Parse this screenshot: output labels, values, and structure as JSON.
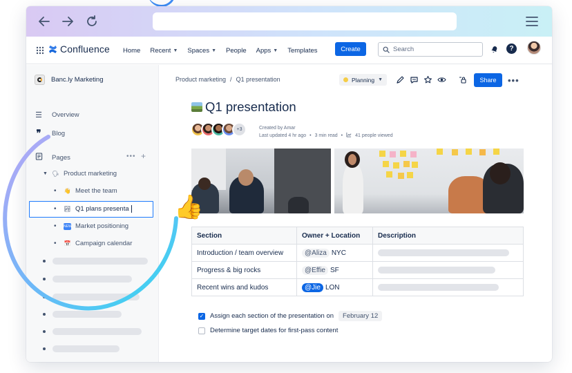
{
  "browser": {
    "back_icon": "arrow-left-icon",
    "forward_icon": "arrow-right-icon",
    "reload_icon": "reload-icon",
    "menu_icon": "hamburger-menu-icon"
  },
  "topnav": {
    "logo_text": "Confluence",
    "items": [
      "Home",
      "Recent",
      "Spaces",
      "People",
      "Apps",
      "Templates"
    ],
    "create_label": "Create",
    "search_placeholder": "Search"
  },
  "sidebar": {
    "space_name": "Banc.ly Marketing",
    "overview_label": "Overview",
    "blog_label": "Blog",
    "pages_label": "Pages",
    "tree": {
      "parent": "Product marketing",
      "children": [
        {
          "label": "Meet the team",
          "emoji": "👋"
        },
        {
          "label": "Q1 plans presenta",
          "emoji": "🏞"
        },
        {
          "label": "Market positioning",
          "emoji": "🆕"
        },
        {
          "label": "Campaign calendar",
          "emoji": "📅"
        }
      ]
    }
  },
  "page": {
    "breadcrumb": [
      "Product marketing",
      "/",
      "Q1 presentation"
    ],
    "status_label": "Planning",
    "share_label": "Share",
    "title": "Q1 presentation",
    "extra_contributors": "+3",
    "created_by": "Created by Amar",
    "last_updated": "Last updated 4 hr ago",
    "read_time": "3 min read",
    "people_viewed": "41 people viewed"
  },
  "table": {
    "headers": [
      "Section",
      "Owner + Location",
      "Description"
    ],
    "rows": [
      {
        "section": "Introduction / team overview",
        "owner": "@Aliza",
        "location": "NYC"
      },
      {
        "section": "Progress & big rocks",
        "owner": "@Effie",
        "location": "SF"
      },
      {
        "section": "Recent wins and kudos",
        "owner": "@Jie",
        "location": "LON"
      }
    ]
  },
  "tasks": [
    {
      "label": "Assign each section of the presentation on",
      "date": "February 12",
      "checked": true
    },
    {
      "label": "Determine target dates for first-pass content",
      "checked": false
    }
  ],
  "colors": {
    "accent": "#0c66e4",
    "status_dot": "#f5cd47",
    "highlight_ring": "#3fd6f0"
  }
}
